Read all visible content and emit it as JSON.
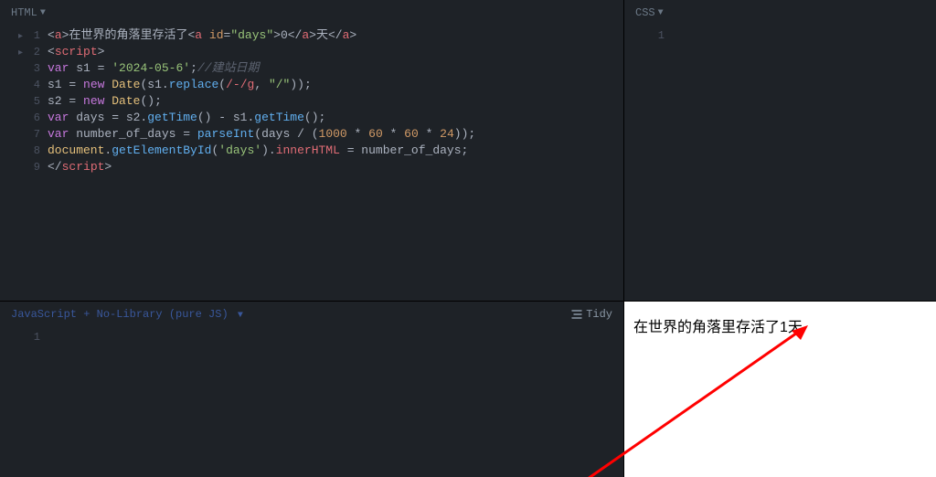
{
  "panes": {
    "html": {
      "label": "HTML"
    },
    "css": {
      "label": "CSS"
    },
    "js": {
      "label": "JavaScript + No-Library (pure JS)"
    },
    "tidy": {
      "label": "Tidy"
    }
  },
  "html_editor": {
    "lines": [
      {
        "n": "1",
        "folded": true,
        "tokens": [
          {
            "t": "<",
            "c": "pun"
          },
          {
            "t": "a",
            "c": "tag"
          },
          {
            "t": ">",
            "c": "pun"
          },
          {
            "t": "在世界的角落里存活了",
            "c": "txt"
          },
          {
            "t": "<",
            "c": "pun"
          },
          {
            "t": "a",
            "c": "tag"
          },
          {
            "t": " ",
            "c": "pun"
          },
          {
            "t": "id",
            "c": "attr"
          },
          {
            "t": "=",
            "c": "pun"
          },
          {
            "t": "\"days\"",
            "c": "str"
          },
          {
            "t": ">",
            "c": "pun"
          },
          {
            "t": "0",
            "c": "txt"
          },
          {
            "t": "</",
            "c": "pun"
          },
          {
            "t": "a",
            "c": "tag"
          },
          {
            "t": ">",
            "c": "pun"
          },
          {
            "t": "天",
            "c": "txt"
          },
          {
            "t": "</",
            "c": "pun"
          },
          {
            "t": "a",
            "c": "tag"
          },
          {
            "t": ">",
            "c": "pun"
          }
        ]
      },
      {
        "n": "2",
        "folded": true,
        "tokens": [
          {
            "t": "<",
            "c": "pun"
          },
          {
            "t": "script",
            "c": "tag"
          },
          {
            "t": ">",
            "c": "pun"
          }
        ]
      },
      {
        "n": "3",
        "tokens": [
          {
            "t": "var",
            "c": "kw"
          },
          {
            "t": " s1 ",
            "c": "txt"
          },
          {
            "t": "=",
            "c": "pun"
          },
          {
            "t": " ",
            "c": "txt"
          },
          {
            "t": "'2024-05-6'",
            "c": "str"
          },
          {
            "t": ";",
            "c": "pun"
          },
          {
            "t": "//建站日期",
            "c": "cmt"
          }
        ]
      },
      {
        "n": "4",
        "tokens": [
          {
            "t": "s1 ",
            "c": "txt"
          },
          {
            "t": "=",
            "c": "pun"
          },
          {
            "t": " ",
            "c": "txt"
          },
          {
            "t": "new",
            "c": "kw"
          },
          {
            "t": " ",
            "c": "txt"
          },
          {
            "t": "Date",
            "c": "obj"
          },
          {
            "t": "(s1.",
            "c": "txt"
          },
          {
            "t": "replace",
            "c": "fn"
          },
          {
            "t": "(",
            "c": "pun"
          },
          {
            "t": "/-/g",
            "c": "var"
          },
          {
            "t": ", ",
            "c": "txt"
          },
          {
            "t": "\"/\"",
            "c": "str"
          },
          {
            "t": "));",
            "c": "pun"
          }
        ]
      },
      {
        "n": "5",
        "tokens": [
          {
            "t": "s2 ",
            "c": "txt"
          },
          {
            "t": "=",
            "c": "pun"
          },
          {
            "t": " ",
            "c": "txt"
          },
          {
            "t": "new",
            "c": "kw"
          },
          {
            "t": " ",
            "c": "txt"
          },
          {
            "t": "Date",
            "c": "obj"
          },
          {
            "t": "();",
            "c": "pun"
          }
        ]
      },
      {
        "n": "6",
        "tokens": [
          {
            "t": "var",
            "c": "kw"
          },
          {
            "t": " days ",
            "c": "txt"
          },
          {
            "t": "=",
            "c": "pun"
          },
          {
            "t": " s2.",
            "c": "txt"
          },
          {
            "t": "getTime",
            "c": "fn"
          },
          {
            "t": "() ",
            "c": "pun"
          },
          {
            "t": "-",
            "c": "pun"
          },
          {
            "t": " s1.",
            "c": "txt"
          },
          {
            "t": "getTime",
            "c": "fn"
          },
          {
            "t": "();",
            "c": "pun"
          }
        ]
      },
      {
        "n": "7",
        "tokens": [
          {
            "t": "var",
            "c": "kw"
          },
          {
            "t": " number_of_days ",
            "c": "txt"
          },
          {
            "t": "=",
            "c": "pun"
          },
          {
            "t": " ",
            "c": "txt"
          },
          {
            "t": "parseInt",
            "c": "fn"
          },
          {
            "t": "(days ",
            "c": "txt"
          },
          {
            "t": "/",
            "c": "pun"
          },
          {
            "t": " (",
            "c": "pun"
          },
          {
            "t": "1000",
            "c": "num"
          },
          {
            "t": " * ",
            "c": "pun"
          },
          {
            "t": "60",
            "c": "num"
          },
          {
            "t": " * ",
            "c": "pun"
          },
          {
            "t": "60",
            "c": "num"
          },
          {
            "t": " * ",
            "c": "pun"
          },
          {
            "t": "24",
            "c": "num"
          },
          {
            "t": "));",
            "c": "pun"
          }
        ]
      },
      {
        "n": "8",
        "tokens": [
          {
            "t": "document",
            "c": "obj"
          },
          {
            "t": ".",
            "c": "pun"
          },
          {
            "t": "getElementById",
            "c": "fn"
          },
          {
            "t": "(",
            "c": "pun"
          },
          {
            "t": "'days'",
            "c": "str"
          },
          {
            "t": ").",
            "c": "pun"
          },
          {
            "t": "innerHTML",
            "c": "var"
          },
          {
            "t": " = number_of_days;",
            "c": "txt"
          }
        ]
      },
      {
        "n": "9",
        "tokens": [
          {
            "t": "</",
            "c": "pun"
          },
          {
            "t": "script",
            "c": "tag"
          },
          {
            "t": ">",
            "c": "pun"
          }
        ]
      }
    ]
  },
  "css_editor": {
    "lines": [
      {
        "n": "1",
        "tokens": []
      }
    ]
  },
  "js_editor": {
    "lines": [
      {
        "n": "1",
        "tokens": []
      }
    ]
  },
  "output": {
    "text": "在世界的角落里存活了1天"
  },
  "arrow_color": "#ff0000"
}
